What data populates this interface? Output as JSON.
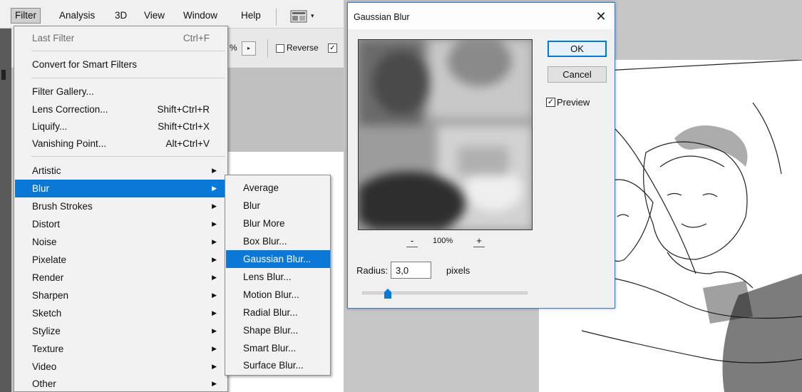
{
  "menubar": {
    "items": [
      {
        "label": "Filter",
        "active": true
      },
      {
        "label": "Analysis"
      },
      {
        "label": "3D"
      },
      {
        "label": "View"
      },
      {
        "label": "Window"
      },
      {
        "label": "Help"
      }
    ],
    "workspace_icon": "workspace-grid-icon",
    "workspace_arrow": "▾"
  },
  "options_bar": {
    "opacity_suffix": "%",
    "stepper_arrow": "▸",
    "reverse_label": "Reverse",
    "reverse_checked": false,
    "second_checkbox_mark": "✓"
  },
  "filter_menu": {
    "last_filter": {
      "label": "Last Filter",
      "shortcut": "Ctrl+F",
      "disabled": true
    },
    "convert_smart": "Convert for Smart Filters",
    "filter_gallery": "Filter Gallery...",
    "lens_correction": {
      "label": "Lens Correction...",
      "shortcut": "Shift+Ctrl+R"
    },
    "liquify": {
      "label": "Liquify...",
      "shortcut": "Shift+Ctrl+X"
    },
    "vanishing_point": {
      "label": "Vanishing Point...",
      "shortcut": "Alt+Ctrl+V"
    },
    "submenus": [
      "Artistic",
      "Blur",
      "Brush Strokes",
      "Distort",
      "Noise",
      "Pixelate",
      "Render",
      "Sharpen",
      "Sketch",
      "Stylize",
      "Texture",
      "Video",
      "Other"
    ],
    "submenu_arrow": "▶",
    "highlighted": "Blur"
  },
  "blur_menu": {
    "items": [
      "Average",
      "Blur",
      "Blur More",
      "Box Blur...",
      "Gaussian Blur...",
      "Lens Blur...",
      "Motion Blur...",
      "Radial Blur...",
      "Shape Blur...",
      "Smart Blur...",
      "Surface Blur..."
    ],
    "highlighted": "Gaussian Blur..."
  },
  "dialog": {
    "title": "Gaussian Blur",
    "close_glyph": "✕",
    "ok_label": "OK",
    "cancel_label": "Cancel",
    "preview_label": "Preview",
    "preview_checked": true,
    "check_glyph": "✓",
    "zoom_out": "-",
    "zoom_in": "+",
    "zoom_level": "100%",
    "radius_label": "Radius:",
    "radius_value": "3,0",
    "radius_unit": "pixels"
  },
  "colors": {
    "highlight": "#0a78d7",
    "menu_bg": "#f2f2f2",
    "dialog_border": "#3b7bd0"
  }
}
